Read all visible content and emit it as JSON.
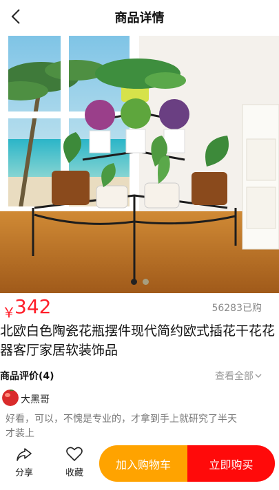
{
  "header": {
    "title": "商品详情",
    "back_icon": "chevron-left-icon"
  },
  "banner": {
    "image": "flower-stand-photo",
    "slide_count": 2,
    "active_slide": 1
  },
  "product": {
    "currency": "￥",
    "price": "342",
    "sold": "56283已购",
    "title": "北欧白色陶瓷花瓶摆件现代简约欧式插花干花花器客厅家居软装饰品"
  },
  "reviews": {
    "title": "商品评价(4)",
    "view_all": "查看全部",
    "view_all_icon": "chevron-down-icon",
    "items": [
      {
        "name": "大黑哥",
        "avatar": "avatar-icon",
        "text": "好看，可以，不愧是专业的，才拿到手上就研究了半天才装上"
      }
    ]
  },
  "bottom_bar": {
    "share_label": "分享",
    "share_icon": "share-icon",
    "fav_label": "收藏",
    "fav_icon": "heart-icon",
    "cart_label": "加入购物车",
    "buy_label": "立即购买"
  },
  "colors": {
    "price": "#ff1f2a",
    "cart_button": "#ffa300",
    "buy_button": "#ff0a0a"
  }
}
